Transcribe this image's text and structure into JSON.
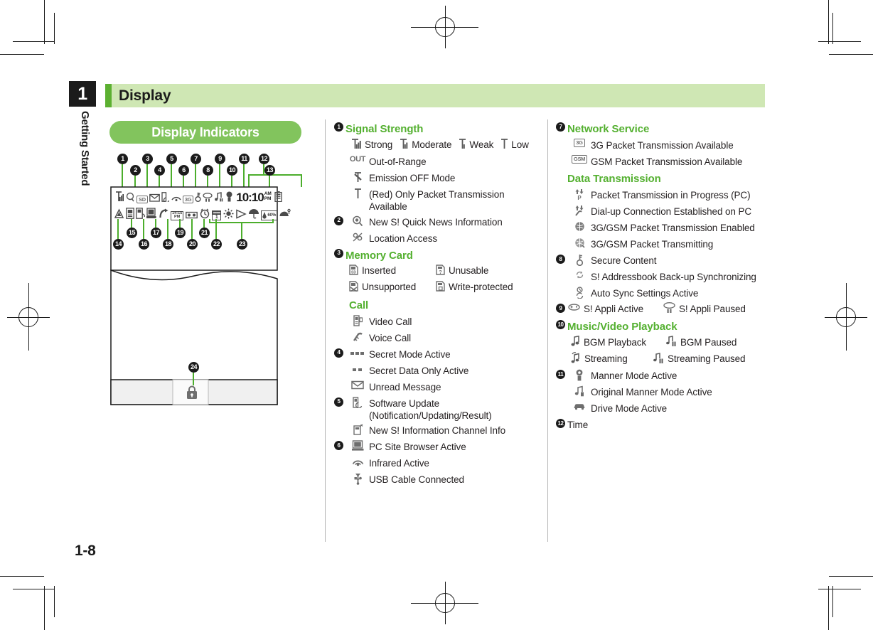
{
  "chapter": {
    "number": "1",
    "label": "Getting Started"
  },
  "page_heading": "Display",
  "section_pill": "Display Indicators",
  "page_number": "1-8",
  "colors": {
    "accent_green": "#54b030",
    "heading_band": "#cfe7b4",
    "pill_green": "#82c45d",
    "leader_green": "#4cae2c",
    "badge_black": "#1b1b1b"
  },
  "phone_mockup": {
    "top_callouts": [
      "1",
      "2",
      "3",
      "4",
      "5",
      "6",
      "7",
      "8",
      "9",
      "10",
      "11",
      "12",
      "13"
    ],
    "bottom_callouts": [
      "14",
      "15",
      "16",
      "17",
      "18",
      "19",
      "20",
      "21",
      "22",
      "23"
    ],
    "key_callout": "24",
    "clock": "10:10",
    "clock_ampm_top": "AM",
    "clock_ampm_bottom": "PM",
    "mini_labels": {
      "badge_3g": "3G",
      "alarm_time": "14:15",
      "alarm_sub": "PM",
      "humidity": "60%",
      "calendar_day": "1"
    }
  },
  "columns": {
    "middle": [
      {
        "num": "1",
        "label": "Signal Strength",
        "type": "heading"
      },
      {
        "type": "pairs",
        "icon": "signal-strength-icons",
        "pairs": [
          {
            "icon": "signal-strong-icon",
            "text": "Strong"
          },
          {
            "icon": "signal-moderate-icon",
            "text": "Moderate"
          },
          {
            "icon": "signal-weak-icon",
            "text": "Weak"
          },
          {
            "icon": "signal-low-icon",
            "text": "Low"
          }
        ]
      },
      {
        "icon": "out-of-range-icon",
        "icon_text": "OUT",
        "label": "Out-of-Range"
      },
      {
        "icon": "emission-off-icon",
        "label": "Emission OFF Mode"
      },
      {
        "icon": "packet-only-icon",
        "label": "(Red) Only Packet Transmission Available"
      },
      {
        "num": "2",
        "icon": "quick-news-icon",
        "label": "New S! Quick News Information"
      },
      {
        "icon": "location-access-icon",
        "label": "Location Access"
      },
      {
        "num": "3",
        "label": "Memory Card",
        "type": "heading"
      },
      {
        "type": "pairs",
        "pairs": [
          {
            "icon": "memory-card-inserted-icon",
            "text": "Inserted"
          },
          {
            "icon": "memory-card-unusable-icon",
            "text": "Unusable"
          }
        ]
      },
      {
        "type": "pairs",
        "pairs": [
          {
            "icon": "memory-card-unsupported-icon",
            "text": "Unsupported"
          },
          {
            "icon": "memory-card-write-protected-icon",
            "text": "Write-protected"
          }
        ]
      },
      {
        "label": "Call",
        "type": "heading"
      },
      {
        "icon": "video-call-icon",
        "label": "Video Call"
      },
      {
        "icon": "voice-call-icon",
        "label": "Voice Call"
      },
      {
        "num": "4",
        "icon": "secret-mode-icon",
        "label": "Secret Mode Active"
      },
      {
        "icon": "secret-data-only-icon",
        "label": "Secret Data Only Active"
      },
      {
        "icon": "unread-message-icon",
        "label": "Unread Message"
      },
      {
        "num": "5",
        "icon": "software-update-icon",
        "label": "Software Update (Notification/Updating/Result)"
      },
      {
        "icon": "info-channel-icon",
        "label": "New S! Information Channel Info"
      },
      {
        "num": "6",
        "icon": "pc-site-browser-icon",
        "label": "PC Site Browser Active"
      },
      {
        "icon": "infrared-icon",
        "label": "Infrared Active"
      },
      {
        "icon": "usb-cable-icon",
        "label": "USB Cable Connected"
      }
    ],
    "right": [
      {
        "num": "7",
        "label": "Network Service",
        "type": "heading"
      },
      {
        "icon": "3g-packet-icon",
        "icon_text": "3G",
        "label": "3G Packet Transmission Available"
      },
      {
        "icon": "gsm-packet-icon",
        "icon_text": "GSM",
        "label": "GSM Packet Transmission Available"
      },
      {
        "label": "Data Transmission",
        "type": "heading"
      },
      {
        "icon": "packet-progress-pc-icon",
        "label": "Packet Transmission in Progress (PC)"
      },
      {
        "icon": "dialup-connection-icon",
        "label": "Dial-up Connection Established on PC"
      },
      {
        "icon": "packet-enabled-icon",
        "label": "3G/GSM Packet Transmission Enabled"
      },
      {
        "icon": "packet-transmitting-icon",
        "label": "3G/GSM Packet Transmitting"
      },
      {
        "num": "8",
        "icon": "secure-content-icon",
        "label": "Secure Content"
      },
      {
        "icon": "addressbook-sync-icon",
        "label": "S! Addressbook Back-up Synchronizing"
      },
      {
        "icon": "auto-sync-icon",
        "label": "Auto Sync Settings Active"
      },
      {
        "num": "9",
        "type": "pairs",
        "pairs": [
          {
            "icon": "s-appli-active-icon",
            "text": "S! Appli Active"
          },
          {
            "icon": "s-appli-paused-icon",
            "text": "S! Appli Paused"
          }
        ]
      },
      {
        "num": "10",
        "label": "Music/Video Playback",
        "type": "heading"
      },
      {
        "type": "pairs",
        "pairs": [
          {
            "icon": "bgm-playback-icon",
            "text": "BGM Playback"
          },
          {
            "icon": "bgm-paused-icon",
            "text": "BGM Paused"
          }
        ]
      },
      {
        "type": "pairs",
        "pairs": [
          {
            "icon": "streaming-icon",
            "text": "Streaming"
          },
          {
            "icon": "streaming-paused-icon",
            "text": "Streaming Paused"
          }
        ]
      },
      {
        "num": "11",
        "icon": "manner-mode-icon",
        "label": "Manner Mode Active"
      },
      {
        "icon": "original-manner-mode-icon",
        "label": "Original Manner Mode Active"
      },
      {
        "icon": "drive-mode-icon",
        "label": "Drive Mode Active"
      },
      {
        "num": "12",
        "label": "Time",
        "type": "plain"
      }
    ]
  }
}
